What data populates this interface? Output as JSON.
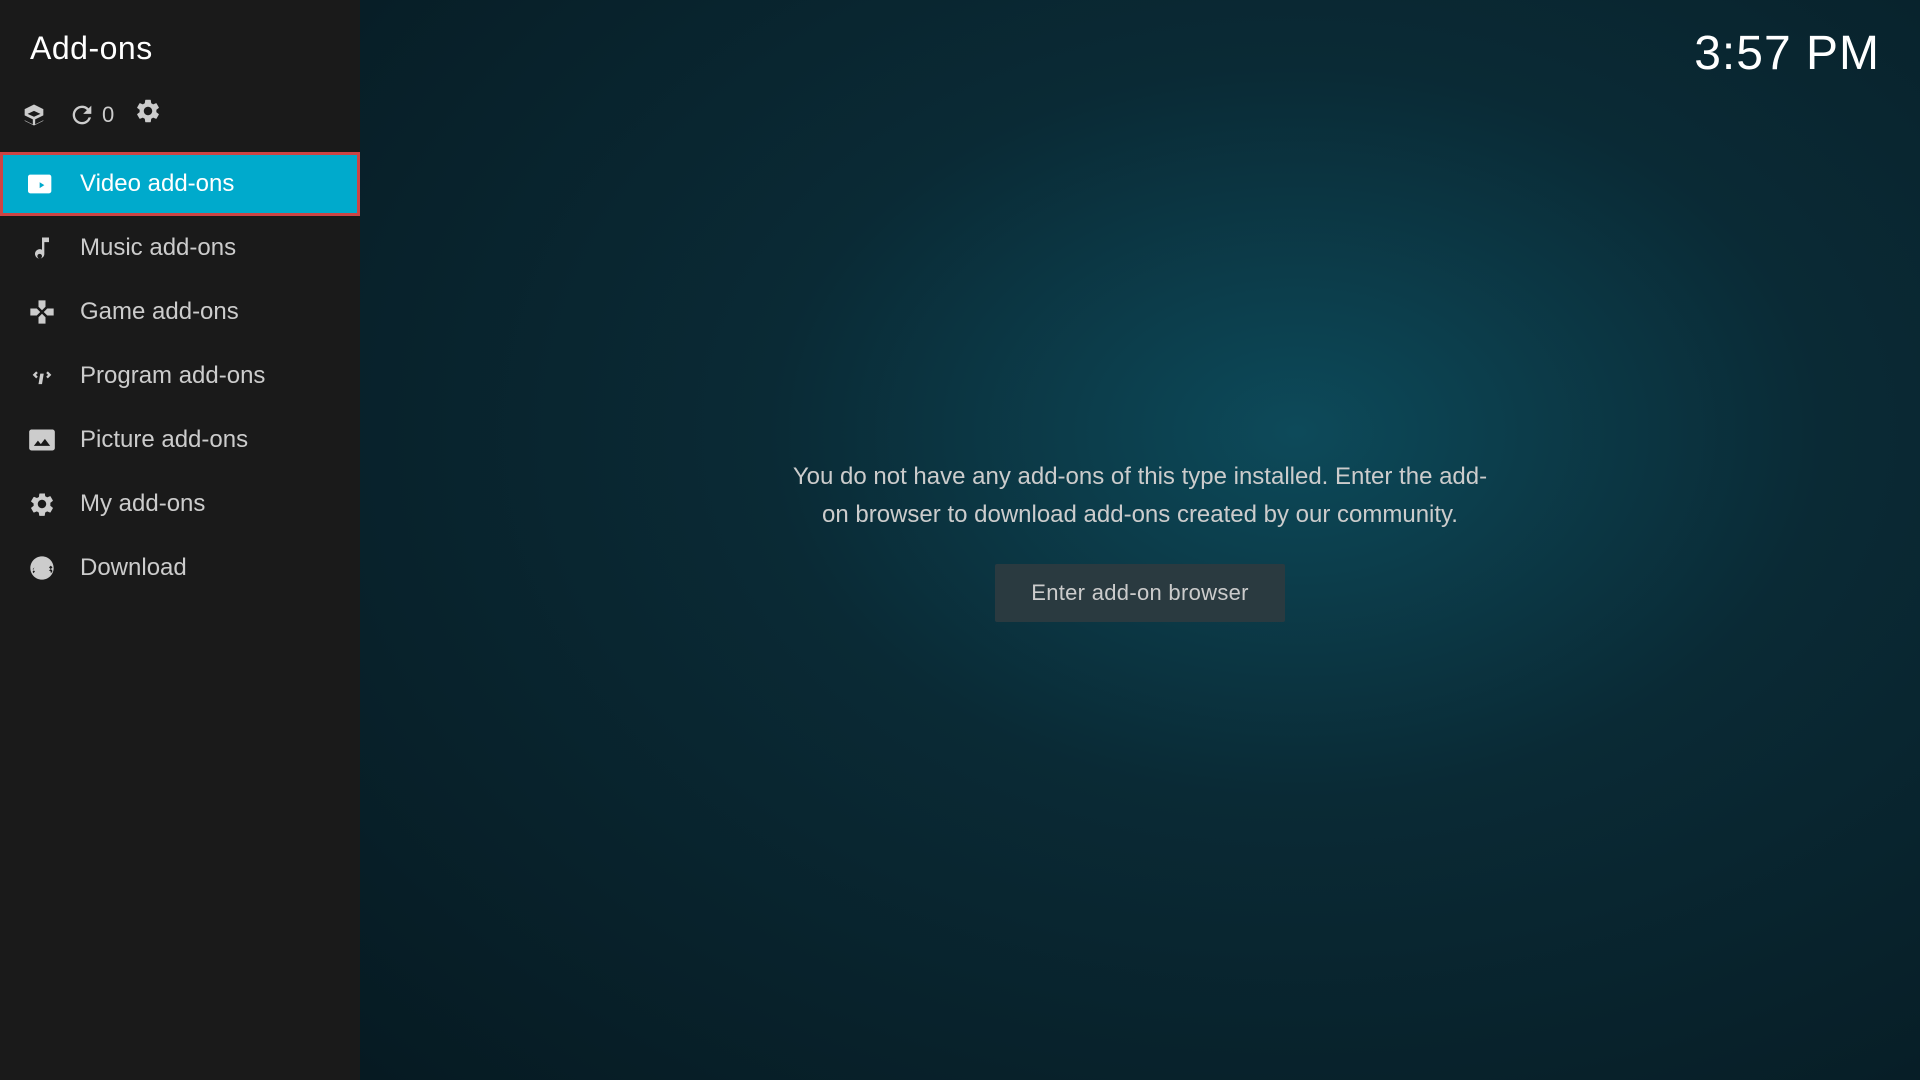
{
  "app": {
    "title": "Add-ons",
    "time": "3:57 PM"
  },
  "toolbar": {
    "refresh_count": "0"
  },
  "nav": {
    "items": [
      {
        "id": "video-add-ons",
        "label": "Video add-ons",
        "icon": "video-icon",
        "active": true
      },
      {
        "id": "music-add-ons",
        "label": "Music add-ons",
        "icon": "music-icon",
        "active": false
      },
      {
        "id": "game-add-ons",
        "label": "Game add-ons",
        "icon": "game-icon",
        "active": false
      },
      {
        "id": "program-add-ons",
        "label": "Program add-ons",
        "icon": "program-icon",
        "active": false
      },
      {
        "id": "picture-add-ons",
        "label": "Picture add-ons",
        "icon": "picture-icon",
        "active": false
      },
      {
        "id": "my-add-ons",
        "label": "My add-ons",
        "icon": "my-addons-icon",
        "active": false
      },
      {
        "id": "download",
        "label": "Download",
        "icon": "download-icon",
        "active": false
      }
    ]
  },
  "main": {
    "empty_message": "You do not have any add-ons of this type installed. Enter the add-on browser to download add-ons created by our community.",
    "browser_button_label": "Enter add-on browser"
  }
}
